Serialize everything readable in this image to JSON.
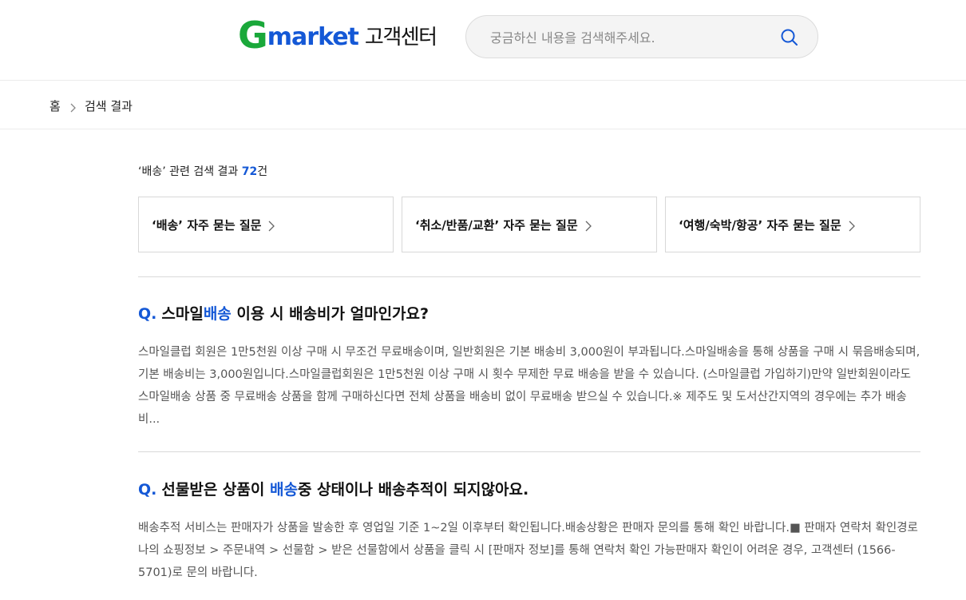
{
  "header": {
    "logo_g": "G",
    "logo_market": "market",
    "logo_cs": "고객센터",
    "search_placeholder": "궁금하신 내용을 검색해주세요.",
    "search_value": "",
    "search_icon": "search-icon"
  },
  "breadcrumb": {
    "home": "홈",
    "separator_icon": "chevron-right-icon",
    "current": "검색 결과"
  },
  "results": {
    "prefix": "‘배송’ 관련 검색 결과 ",
    "count": "72",
    "suffix": "건"
  },
  "faq_cards": [
    {
      "label": "‘배송’ 자주 묻는 질문"
    },
    {
      "label": "‘취소/반품/교환’ 자주 묻는 질문"
    },
    {
      "label": "‘여행/숙박/항공’ 자주 묻는 질문"
    }
  ],
  "qa_items": [
    {
      "q_mark": "Q.",
      "title_before": "스마일",
      "title_highlight": "배송",
      "title_after": " 이용 시 배송비가 얼마인가요?",
      "body": "스마일클럽 회원은 1만5천원 이상 구매 시 무조건 무료배송이며, 일반회원은 기본 배송비 3,000원이 부과됩니다.스마일배송을 통해 상품을 구매 시 묶음배송되며, 기본 배송비는 3,000원입니다.스마일클럽회원은 1만5천원 이상 구매 시 횟수 무제한 무료 배송을 받을 수 있습니다. (스마일클럽 가입하기)만약 일반회원이라도 스마일배송 상품 중 무료배송 상품을 함께 구매하신다면 전체 상품을 배송비 없이 무료배송 받으실 수 있습니다.※ 제주도 및 도서산간지역의 경우에는 추가 배송비..."
    },
    {
      "q_mark": "Q.",
      "title_before": "선물받은 상품이 ",
      "title_highlight": "배송",
      "title_after": "중 상태이나 배송추적이 되지않아요.",
      "body": "배송추적 서비스는 판매자가 상품을 발송한 후 영업일 기준 1~2일 이후부터 확인됩니다.배송상황은 판매자 문의를 통해 확인 바랍니다.■ 판매자 연락처 확인경로나의 쇼핑정보 > 주문내역 > 선물함 > 받은 선물함에서 상품을 클릭 시 [판매자 정보]를 통해 연락처 확인 가능판매자 확인이 어려운 경우, 고객센터 (1566-5701)로 문의 바랍니다."
    }
  ],
  "colors": {
    "accent_blue": "#1458d6",
    "logo_green": "#1aa83a",
    "body_text": "#555555",
    "divider": "#d9d9d9"
  }
}
